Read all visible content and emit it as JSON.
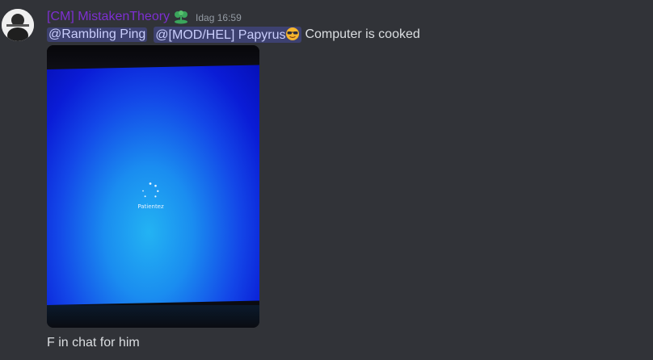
{
  "message": {
    "username": "[CM] MistakenTheory",
    "timestamp": "Idag 16:59",
    "role_icon": "green-sprout-icon",
    "mentions": [
      "@Rambling Ping",
      "@[MOD/HEL] Papyrus"
    ],
    "mention_emoji": "sunglasses-emoji",
    "text": "Computer is cooked",
    "attachment": {
      "label": "Patientez",
      "description_icon": "loading-spinner-icon"
    },
    "followup_text": "F in chat for him"
  },
  "colors": {
    "background": "#313338",
    "username": "#7d2fd1",
    "mention_bg": "#414675",
    "mention_text": "#c9cdfb",
    "text": "#dbdee1",
    "timestamp": "#949ba4"
  }
}
